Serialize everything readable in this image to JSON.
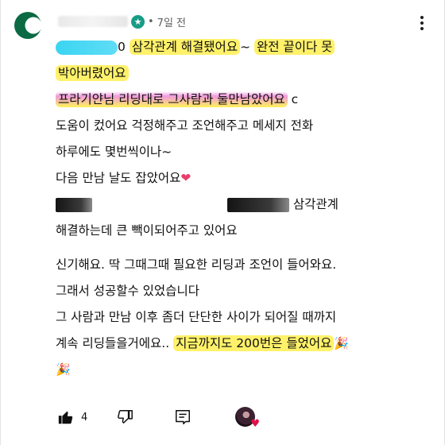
{
  "comment": {
    "avatar_icon": "starbucks-logo-icon",
    "author_badge_icon": "star-badge-icon",
    "separator": "•",
    "time": "7일 전",
    "lines": {
      "l1_tail": "0",
      "l1_a": "삼각관계 해결됐어요",
      "l1_b": "~ ",
      "l1_c": "완전 끝이다 못",
      "l2": "박아버렸어요",
      "l3": "프라기얀님 리딩대로 그사람과 둘만남았어요",
      "l3_tail": " c",
      "l4": "도움이 컸어요 걱정해주고 조언해주고 메세지 전화",
      "l5": "하루에도 몇번씩이나~",
      "l6": "다음 만남 날도 잡았어요",
      "l6_emoji": "❤",
      "l7": "삼각관계",
      "l8": "해결하는데 큰 빽이되어주고 있어요",
      "l9": "신기해요. 딱 그때그때 필요한 리딩과 조언이 들어와요.",
      "l10": "그래서 성공할수 있었습니다",
      "l11": "그 사람과 만남 이후 좀더 단단한 사이가 되어질 때까지",
      "l12_a": "계속 리딩들을거에요.. ",
      "l12_b": "지금까지도 200번은 들었어요",
      "l12_emoji": "🎉",
      "l13_emoji": "🎉"
    }
  },
  "actions": {
    "like_icon": "thumbs-up-icon",
    "like_count": "4",
    "dislike_icon": "thumbs-down-icon",
    "reply_icon": "reply-comment-icon",
    "creator_heart_icon": "creator-heart-icon"
  },
  "menu_icon": "more-vertical-icon",
  "colors": {
    "highlight_yellow": "#ffee50",
    "highlight_pink": "#eb78d2",
    "highlight_cyan": "#24d1f0",
    "avatar_green": "#0b6a43"
  }
}
